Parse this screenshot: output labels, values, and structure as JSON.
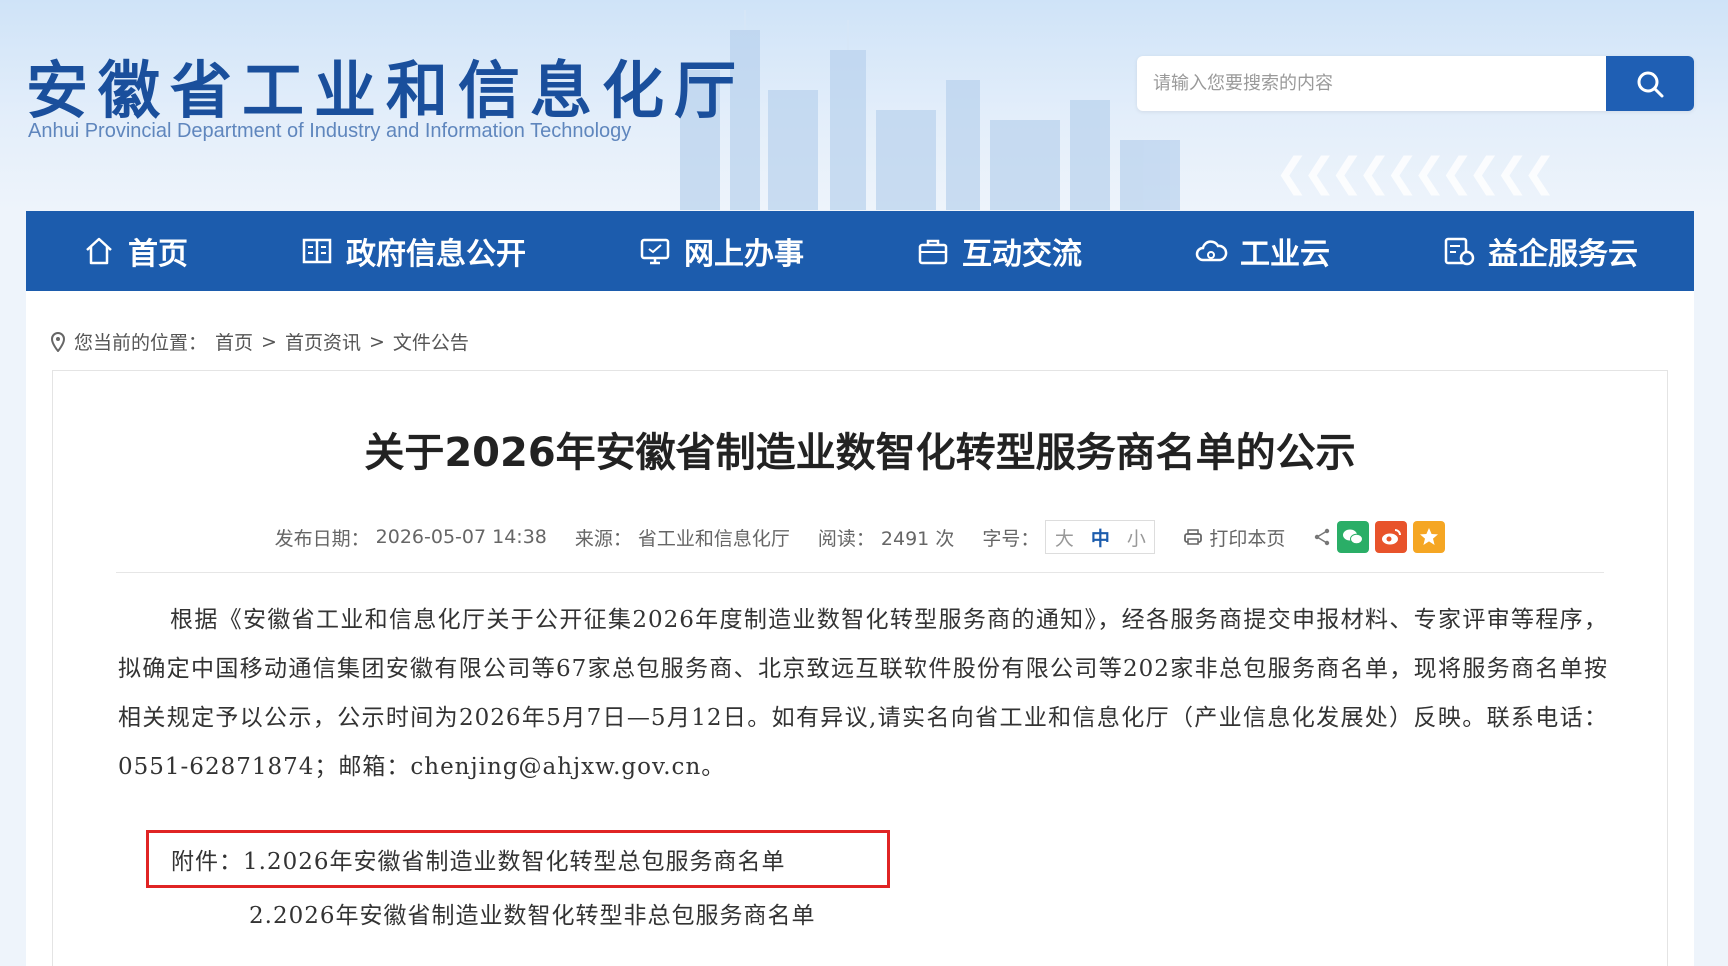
{
  "header": {
    "title": "安徽省工业和信息化厅",
    "subtitle": "Anhui Provincial Department of Industry and Information Technology",
    "search_placeholder": "请输入您要搜索的内容",
    "chevrons": "❮❮❮❮❮❮❮❮❮❮"
  },
  "nav": {
    "items": [
      {
        "label": "首页",
        "icon": "home-icon"
      },
      {
        "label": "政府信息公开",
        "icon": "book-icon"
      },
      {
        "label": "网上办事",
        "icon": "monitor-icon"
      },
      {
        "label": "互动交流",
        "icon": "briefcase-icon"
      },
      {
        "label": "工业云",
        "icon": "cloud-icon"
      },
      {
        "label": "益企服务云",
        "icon": "service-icon"
      }
    ]
  },
  "breadcrumb": {
    "prefix": "您当前的位置：",
    "items": [
      "首页",
      "首页资讯",
      "文件公告"
    ],
    "separator": ">"
  },
  "article": {
    "title": "关于2026年安徽省制造业数智化转型服务商名单的公示",
    "meta": {
      "date_label": "发布日期：",
      "date": "2026-05-07 14:38",
      "source_label": "来源：",
      "source": "省工业和信息化厅",
      "views_label": "阅读：",
      "views": "2491 次",
      "fontsize_label": "字号：",
      "fontsize_options": [
        "大",
        "中",
        "小"
      ],
      "print_label": "打印本页"
    },
    "body": "根据《安徽省工业和信息化厅关于公开征集2026年度制造业数智化转型服务商的通知》，经各服务商提交申报材料、专家评审等程序，拟确定中国移动通信集团安徽有限公司等67家总包服务商、北京致远互联软件股份有限公司等202家非总包服务商名单，现将服务商名单按相关规定予以公示，公示时间为2026年5月7日—5月12日。如有异议,请实名向省工业和信息化厅（产业信息化发展处）反映。联系电话：0551-62871874；邮箱：chenjing@ahjxw.gov.cn。",
    "attachment_label": "附件：",
    "attachments": [
      "1.2026年安徽省制造业数智化转型总包服务商名单",
      "2.2026年安徽省制造业数智化转型非总包服务商名单"
    ]
  },
  "colors": {
    "nav_bg": "#1c5cad",
    "title_blue": "#1a4f9c",
    "highlight_red": "#e02424",
    "wechat_green": "#2aae67",
    "weibo_orange": "#e8532b",
    "fav_orange": "#f5a623"
  }
}
